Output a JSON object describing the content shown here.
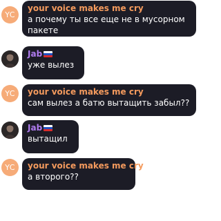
{
  "messages": [
    {
      "avatar_text": "YC",
      "sender": "your voice makes me cry",
      "text_lines": [
        "а почему ты все еще не в мусорном",
        "пакете"
      ]
    },
    {
      "avatar_icon": "user-photo-icon",
      "sender": "Jab",
      "sender_badge": "russian-flag-icon",
      "text_lines": [
        "уже вылез"
      ]
    },
    {
      "avatar_text": "YC",
      "sender": "your voice makes me cry",
      "text_lines": [
        "сам вылез а батю вытащить забыл??"
      ]
    },
    {
      "avatar_icon": "user-photo-icon",
      "sender": "Jab",
      "sender_badge": "russian-flag-icon",
      "text_lines": [
        "вытащил"
      ]
    },
    {
      "avatar_text": "YC",
      "sender": "your voice makes me cry",
      "text_lines": [
        "а второго??"
      ]
    }
  ],
  "colors": {
    "bubble": "#1c1c26",
    "yc_avatar": "#f6ab78",
    "yc_name": "#f49a5d",
    "jab_name": "#b07cf0",
    "text": "#ffffff"
  }
}
